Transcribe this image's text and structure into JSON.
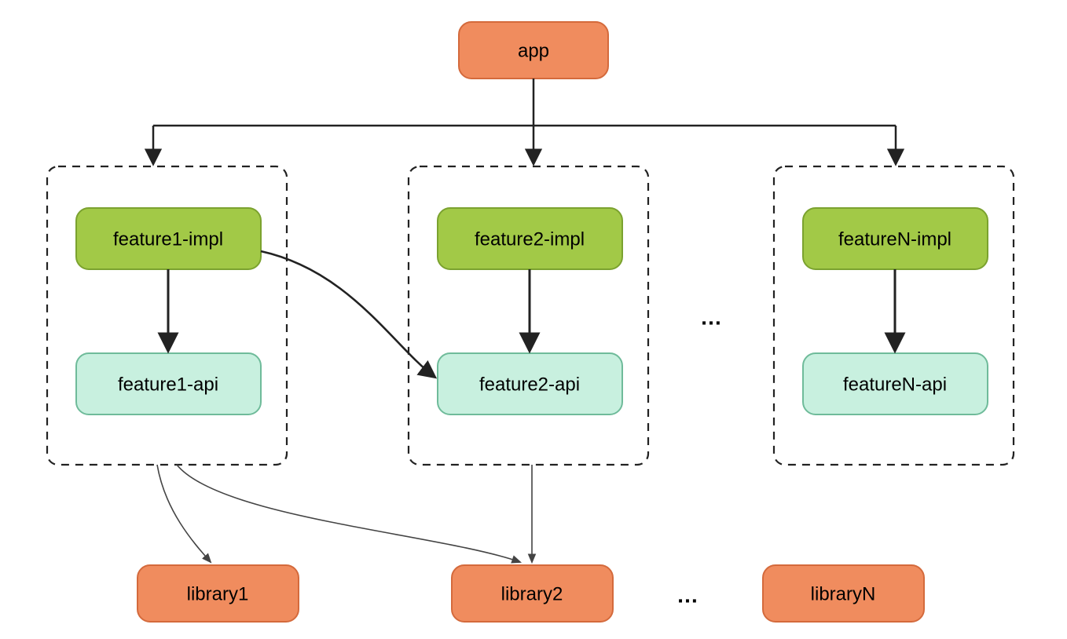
{
  "colors": {
    "orange_fill": "#f08c5e",
    "orange_stroke": "#d46a3c",
    "green_fill": "#a2c947",
    "green_stroke": "#7ba22f",
    "mint_fill": "#c8f0df",
    "mint_stroke": "#6fbb9a",
    "dash_stroke": "#222222",
    "arrow_stroke": "#222222",
    "thin_arrow_stroke": "#444444"
  },
  "nodes": {
    "app": "app",
    "feature1_impl": "feature1-impl",
    "feature1_api": "feature1-api",
    "feature2_impl": "feature2-impl",
    "feature2_api": "feature2-api",
    "featureN_impl": "featureN-impl",
    "featureN_api": "featureN-api",
    "library1": "library1",
    "library2": "library2",
    "libraryN": "libraryN"
  },
  "ellipsis": "…",
  "chart_data": {
    "type": "graph",
    "description": "Module dependency diagram: app depends on multiple feature groups (feature1..featureN). Each feature group has an -impl module depending on its -api module. feature1-impl also depends on feature2-api. Feature groups depend on shared libraries (library1..libraryN).",
    "nodes": [
      {
        "id": "app",
        "label": "app",
        "kind": "app",
        "color": "orange"
      },
      {
        "id": "feature1-group",
        "label": "",
        "kind": "group"
      },
      {
        "id": "feature2-group",
        "label": "",
        "kind": "group"
      },
      {
        "id": "featureN-group",
        "label": "",
        "kind": "group"
      },
      {
        "id": "feature1-impl",
        "label": "feature1-impl",
        "kind": "impl",
        "color": "green",
        "group": "feature1-group"
      },
      {
        "id": "feature1-api",
        "label": "feature1-api",
        "kind": "api",
        "color": "mint",
        "group": "feature1-group"
      },
      {
        "id": "feature2-impl",
        "label": "feature2-impl",
        "kind": "impl",
        "color": "green",
        "group": "feature2-group"
      },
      {
        "id": "feature2-api",
        "label": "feature2-api",
        "kind": "api",
        "color": "mint",
        "group": "feature2-group"
      },
      {
        "id": "featureN-impl",
        "label": "featureN-impl",
        "kind": "impl",
        "color": "green",
        "group": "featureN-group"
      },
      {
        "id": "featureN-api",
        "label": "featureN-api",
        "kind": "api",
        "color": "mint",
        "group": "featureN-group"
      },
      {
        "id": "library1",
        "label": "library1",
        "kind": "library",
        "color": "orange"
      },
      {
        "id": "library2",
        "label": "library2",
        "kind": "library",
        "color": "orange"
      },
      {
        "id": "libraryN",
        "label": "libraryN",
        "kind": "library",
        "color": "orange"
      }
    ],
    "edges": [
      {
        "from": "app",
        "to": "feature1-group"
      },
      {
        "from": "app",
        "to": "feature2-group"
      },
      {
        "from": "app",
        "to": "featureN-group"
      },
      {
        "from": "feature1-impl",
        "to": "feature1-api"
      },
      {
        "from": "feature2-impl",
        "to": "feature2-api"
      },
      {
        "from": "featureN-impl",
        "to": "featureN-api"
      },
      {
        "from": "feature1-impl",
        "to": "feature2-api",
        "style": "curved"
      },
      {
        "from": "feature1-group",
        "to": "library1",
        "style": "thin-curved"
      },
      {
        "from": "feature1-group",
        "to": "library2",
        "style": "thin-curved"
      },
      {
        "from": "feature2-group",
        "to": "library2",
        "style": "thin"
      }
    ],
    "ellipsis_between": [
      [
        "feature2-group",
        "featureN-group"
      ],
      [
        "library2",
        "libraryN"
      ]
    ]
  }
}
